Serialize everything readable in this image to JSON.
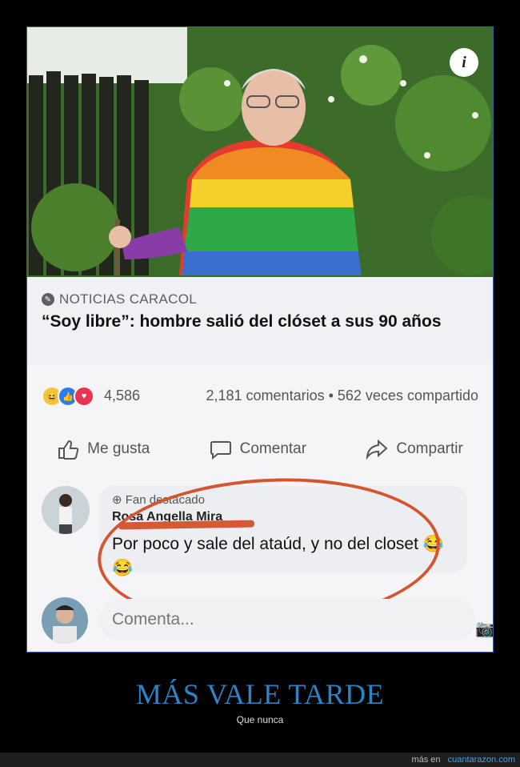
{
  "post": {
    "source_name": "NOTICIAS CARACOL",
    "headline": "“Soy libre”: hombre salió del clóset a sus 90 años",
    "reaction_count": "4,586",
    "comments_shares": "2,181 comentarios • 562 veces compartido",
    "actions": {
      "like": "Me gusta",
      "comment": "Comentar",
      "share": "Compartir"
    }
  },
  "comment": {
    "badge": "Fan destacado",
    "author": "Rosa Angella Mira",
    "text": "Por poco y sale del ataúd, y no del closet 😂😂"
  },
  "input": {
    "placeholder": "Comenta..."
  },
  "caption": {
    "title": "MÁS VALE TARDE",
    "subtitle": "Que nunca"
  },
  "footer": {
    "prefix": "más en",
    "site": "cuantarazon.com"
  }
}
